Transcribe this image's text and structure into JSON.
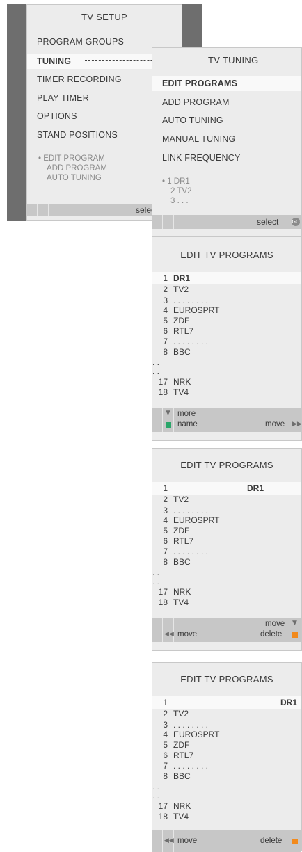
{
  "setup_menu": {
    "title": "TV SETUP",
    "items": [
      "PROGRAM GROUPS",
      "TUNING",
      "TIMER RECORDING",
      "PLAY TIMER",
      "OPTIONS",
      "STAND POSITIONS"
    ],
    "highlighted": "TUNING",
    "sub_items": [
      "• EDIT PROGRAM",
      "ADD PROGRAM",
      "AUTO TUNING"
    ],
    "footer_label": "select"
  },
  "tuning_menu": {
    "title": "TV TUNING",
    "items": [
      "EDIT PROGRAMS",
      "ADD PROGRAM",
      "AUTO TUNING",
      "MANUAL TUNING",
      "LINK FREQUENCY"
    ],
    "highlighted": "EDIT PROGRAMS",
    "sub_items": [
      "• 1 DR1",
      "2 TV2",
      "3 . . ."
    ],
    "footer_label": "select",
    "footer_icon": "GO"
  },
  "edit_1": {
    "title": "EDIT TV PROGRAMS",
    "rows": [
      {
        "num": "1",
        "name": "DR1"
      },
      {
        "num": "2",
        "name": "TV2"
      },
      {
        "num": "3",
        "name": ". . . . . . . ."
      },
      {
        "num": "4",
        "name": "EUROSPRT"
      },
      {
        "num": "5",
        "name": "ZDF"
      },
      {
        "num": "6",
        "name": "RTL7"
      },
      {
        "num": "7",
        "name": ". . . . . . . ."
      },
      {
        "num": "8",
        "name": "BBC"
      },
      {
        "num": ". .",
        "name": ""
      },
      {
        "num": ". .",
        "name": ""
      },
      {
        "num": "17",
        "name": "NRK"
      },
      {
        "num": "18",
        "name": "TV4"
      }
    ],
    "footer": {
      "more": "more",
      "name": "name",
      "move": "move"
    }
  },
  "edit_2": {
    "title": "EDIT TV PROGRAMS",
    "rows": [
      {
        "num": "1",
        "name": ""
      },
      {
        "num": "2",
        "name": "TV2"
      },
      {
        "num": "3",
        "name": ". . . . . . . ."
      },
      {
        "num": "4",
        "name": "EUROSPRT"
      },
      {
        "num": "5",
        "name": "ZDF"
      },
      {
        "num": "6",
        "name": "RTL7"
      },
      {
        "num": "7",
        "name": ". . . . . . . ."
      },
      {
        "num": "8",
        "name": "BBC"
      },
      {
        "num": ". .",
        "name": ""
      },
      {
        "num": ". .",
        "name": ""
      },
      {
        "num": "17",
        "name": "NRK"
      },
      {
        "num": "18",
        "name": "TV4"
      }
    ],
    "moving_name": "DR1",
    "footer": {
      "move_left": "move",
      "move_right": "move",
      "delete": "delete"
    }
  },
  "edit_3": {
    "title": "EDIT TV PROGRAMS",
    "rows": [
      {
        "num": "1",
        "name": ""
      },
      {
        "num": "2",
        "name": "TV2"
      },
      {
        "num": "3",
        "name": ". . . . . . . ."
      },
      {
        "num": "4",
        "name": "EUROSPRT"
      },
      {
        "num": "5",
        "name": "ZDF"
      },
      {
        "num": "6",
        "name": "RTL7"
      },
      {
        "num": "7",
        "name": ". . . . . . . ."
      },
      {
        "num": "8",
        "name": "BBC"
      },
      {
        "num": ". .",
        "name": ""
      },
      {
        "num": ". .",
        "name": ""
      },
      {
        "num": "17",
        "name": "NRK"
      },
      {
        "num": "18",
        "name": "TV4"
      }
    ],
    "moving_name": "DR1",
    "footer": {
      "move": "move",
      "delete": "delete"
    }
  },
  "colors": {
    "green": "#2aa66a",
    "orange": "#f28a1c",
    "panel": "#ececec",
    "bar": "#c7c7c7"
  }
}
